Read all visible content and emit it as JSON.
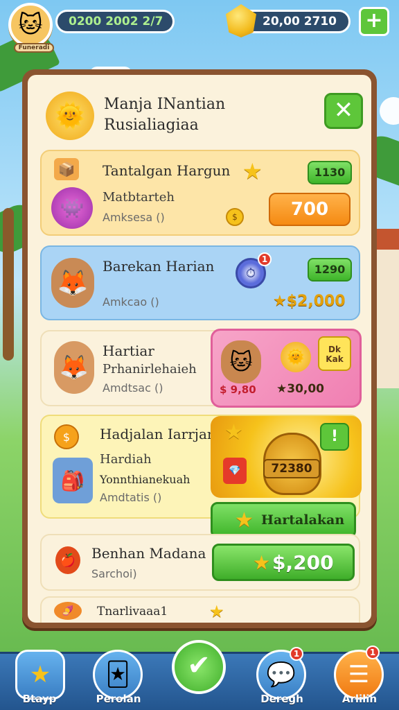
{
  "hud": {
    "left_value": "0200 2002 2/7",
    "right_value": "20,00 2710",
    "avatar_tag": "Funeradi",
    "plus_label": "+"
  },
  "panel": {
    "title_line1": "Manja INantian",
    "title_line2": "Rusialiagiaa",
    "close_label": "✕"
  },
  "cards": [
    {
      "title": "Tantalgan Hargun",
      "badge": "1130",
      "sub": "Matbtarteh",
      "tiny": "Amksesa ()",
      "price": "700"
    },
    {
      "title": "Barekan Harian",
      "badge": "1290",
      "tiny": "Amkcao ()",
      "reward": "★$2,000",
      "notif": "1"
    },
    {
      "title": "Hartiar",
      "sub": "Prhanirlehaieh",
      "tiny": "Amdtsac ()",
      "promo_left": "$ 9,80",
      "promo_right": "★30,00",
      "tag": "Dk Kak"
    },
    {
      "title": "Hadjalan Iarrjan",
      "sub": "Hardiah",
      "sub2": "Yonnthianekuah",
      "tiny": "Amdtatis ()",
      "jar_value": "72380",
      "btn_label": "Hartalakan",
      "alert": "!"
    },
    {
      "title": "Benhan Madana",
      "tiny": "Sarchoi)",
      "reward_btn": "$,200"
    },
    {
      "title": "Tnarlivaaa1"
    }
  ],
  "nav": {
    "items": [
      {
        "label": "Btayp",
        "icon": "star-icon"
      },
      {
        "label": "Perolan",
        "icon": "card-icon"
      },
      {
        "label": "Deregh",
        "icon": "chat-icon",
        "notif": "1"
      },
      {
        "label": "Arlilin",
        "icon": "menu-icon",
        "notif": "1"
      }
    ]
  }
}
